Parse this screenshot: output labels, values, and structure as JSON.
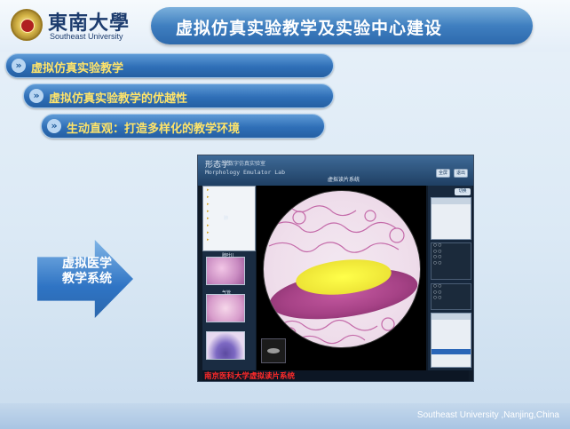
{
  "header": {
    "logo_cn": "東南大學",
    "logo_en": "Southeast University",
    "title": "虚拟仿真实验教学及实验中心建设"
  },
  "nav": [
    {
      "label": "虚拟仿真实验教学"
    },
    {
      "label": "虚拟仿真实验教学的优越性"
    },
    {
      "label": "生动直观：打造多样化的教学环境"
    }
  ],
  "arrow_block": {
    "text": "虚拟医学教学系统"
  },
  "app": {
    "logo_cn": "形态学",
    "logo_sub": "数字仿真实验室",
    "logo_en": "Morphology Emulator Lab",
    "window_title": "虚拟读片系统",
    "top_buttons": [
      "全屏",
      "退出"
    ],
    "panel_button": "切换",
    "status_red": "南京医科大学虚拟读片系统",
    "thumb_captions": [
      "肺",
      "肺叶II",
      "气管"
    ]
  },
  "footer": {
    "text": "Southeast University ,Nanjing,China"
  },
  "colors": {
    "title_bar": "#2d6aad",
    "nav_label": "#ffe46a",
    "status_red": "#ff2a2a"
  }
}
